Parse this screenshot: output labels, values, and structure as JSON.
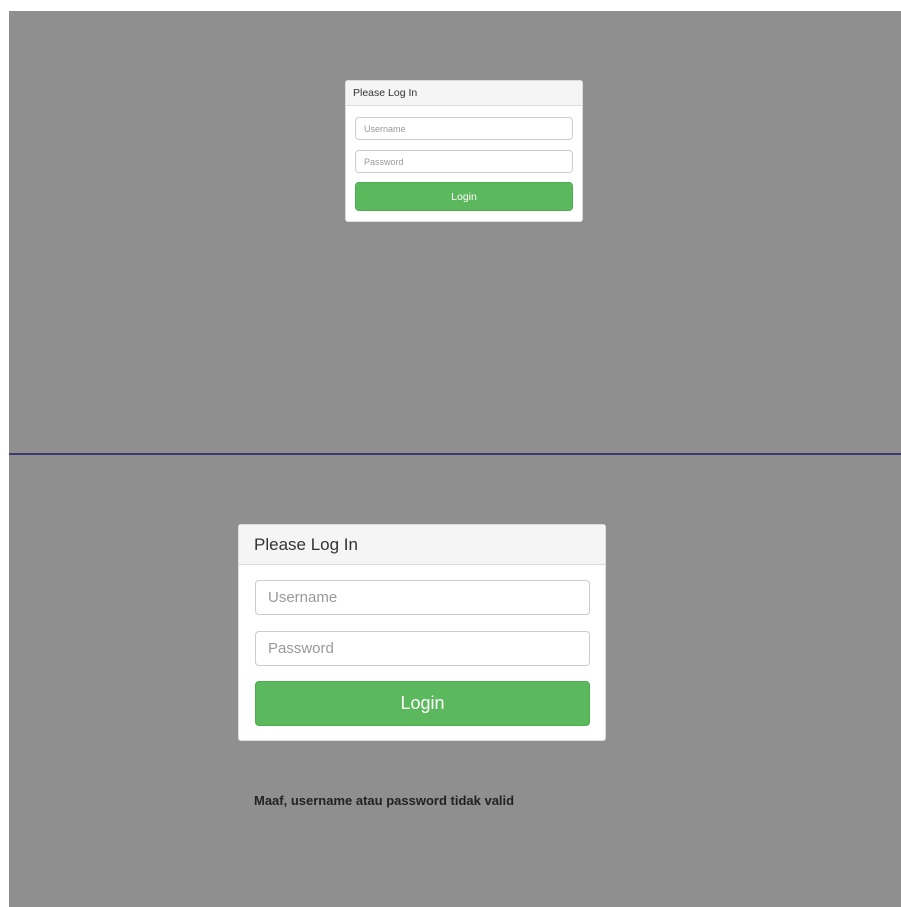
{
  "top_form": {
    "heading": "Please Log In",
    "username_placeholder": "Username",
    "password_placeholder": "Password",
    "login_label": "Login"
  },
  "bottom_form": {
    "heading": "Please Log In",
    "username_placeholder": "Username",
    "password_placeholder": "Password",
    "login_label": "Login"
  },
  "error_message": "Maaf, username atau password tidak valid",
  "colors": {
    "background": "#8f8f8f",
    "login_button": "#5cb85c",
    "divider": "#3a3a6e"
  }
}
